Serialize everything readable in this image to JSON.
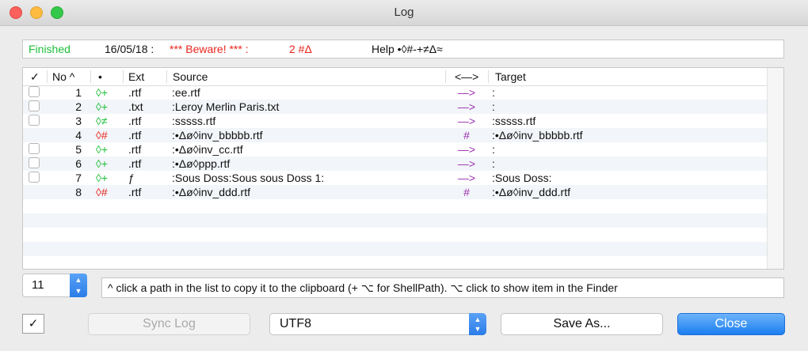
{
  "window": {
    "title": "Log"
  },
  "status": {
    "state": "Finished",
    "date": "16/05/18 :",
    "warning": "*** Beware! *** :",
    "count": "2 #Δ",
    "help": "Help •◊#-+≠Δ≈",
    "colors": {
      "state": "#1cbf3a",
      "warning": "#e8261e"
    }
  },
  "table": {
    "headers": {
      "check": "✓",
      "no": "No ^",
      "dot": "•",
      "ext": "Ext",
      "source": "Source",
      "arrow": "<—>",
      "target": "Target"
    },
    "rows": [
      {
        "checkbox": true,
        "no": "1",
        "flag": "◊+",
        "flag_color": "#1cbf3a",
        "ext": ".rtf",
        "source": ":ee.rtf",
        "arrow": "—>",
        "target": ":"
      },
      {
        "checkbox": true,
        "no": "2",
        "flag": "◊+",
        "flag_color": "#1cbf3a",
        "ext": ".txt",
        "source": ":Leroy Merlin Paris.txt",
        "arrow": "—>",
        "target": ":"
      },
      {
        "checkbox": true,
        "no": "3",
        "flag": "◊≠",
        "flag_color": "#1cbf3a",
        "ext": ".rtf",
        "source": ":sssss.rtf",
        "arrow": "—>",
        "target": ":sssss.rtf"
      },
      {
        "checkbox": false,
        "no": "4",
        "flag": "◊#",
        "flag_color": "#e8261e",
        "ext": ".rtf",
        "source": ":•Δø◊inv_bbbbb.rtf",
        "arrow": "#",
        "target": ":•Δø◊inv_bbbbb.rtf"
      },
      {
        "checkbox": true,
        "no": "5",
        "flag": "◊+",
        "flag_color": "#1cbf3a",
        "ext": ".rtf",
        "source": ":•Δø◊inv_cc.rtf",
        "arrow": "—>",
        "target": ":"
      },
      {
        "checkbox": true,
        "no": "6",
        "flag": "◊+",
        "flag_color": "#1cbf3a",
        "ext": ".rtf",
        "source": ":•Δø◊ppp.rtf",
        "arrow": "—>",
        "target": ":"
      },
      {
        "checkbox": true,
        "no": "7",
        "flag": "◊+",
        "flag_color": "#1cbf3a",
        "ext": "ƒ",
        "source": ":Sous Doss:Sous sous Doss 1:",
        "arrow": "—>",
        "target": ":Sous Doss:"
      },
      {
        "checkbox": false,
        "no": "8",
        "flag": "◊#",
        "flag_color": "#e8261e",
        "ext": ".rtf",
        "source": ":•Δø◊inv_ddd.rtf",
        "arrow": "#",
        "target": ":•Δø◊inv_ddd.rtf"
      }
    ],
    "arrow_color": "#9b2fae"
  },
  "stepper": {
    "value": "11"
  },
  "hint": "^ click a path in the list to copy it to the clipboard (+ ⌥ for ShellPath). ⌥ click to show item in the Finder",
  "footer": {
    "check_label": "✓",
    "sync_label": "Sync Log",
    "encoding": "UTF8",
    "save_label": "Save As...",
    "close_label": "Close"
  }
}
